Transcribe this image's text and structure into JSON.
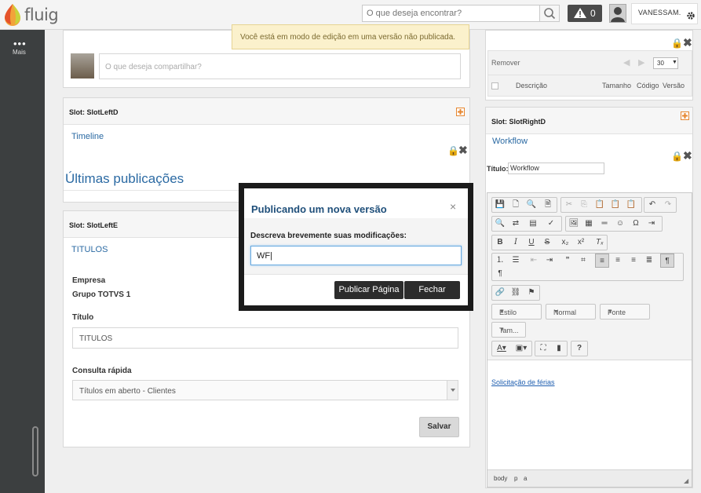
{
  "header": {
    "logo_text": "fluig",
    "search_placeholder": "O que deseja encontrar?",
    "alerts_count": "0",
    "user_name": "VANESSAM."
  },
  "sidebar": {
    "more_label": "Mais"
  },
  "notice": {
    "text": "Você está em modo de edição em uma versão não publicada."
  },
  "share": {
    "placeholder": "O que deseja compartilhar?"
  },
  "slot_left_d": {
    "title": "Slot: SlotLeftD",
    "link": "Timeline",
    "heading": "Últimas publicações"
  },
  "slot_left_e": {
    "title": "Slot: SlotLeftE",
    "link": "TITULOS",
    "company_label": "Empresa",
    "company_value": "Grupo TOTVS 1",
    "title_label": "Título",
    "title_value": "TITULOS",
    "quick_label": "Consulta rápida",
    "quick_value": "Títulos em aberto - Clientes",
    "save_label": "Salvar"
  },
  "right_docs": {
    "remove_label": "Remover",
    "page_size": "30",
    "columns": [
      "Descrição",
      "Tamanho",
      "Código",
      "Versão"
    ]
  },
  "slot_right_d": {
    "title": "Slot: SlotRightD",
    "link": "Workflow",
    "title_label": "Título:",
    "title_value": "Workflow",
    "style_select": "Estilo",
    "format_select": "Normal",
    "font_select": "Fonte",
    "size_select": "Tam...",
    "content_link": "Solicitação de férias",
    "status_path": [
      "body",
      "p",
      "a"
    ]
  },
  "modal": {
    "title": "Publicando um nova versão",
    "label": "Descreva brevemente suas modificações:",
    "input_value": "WF|",
    "publish_label": "Publicar Página",
    "close_label": "Fechar"
  }
}
